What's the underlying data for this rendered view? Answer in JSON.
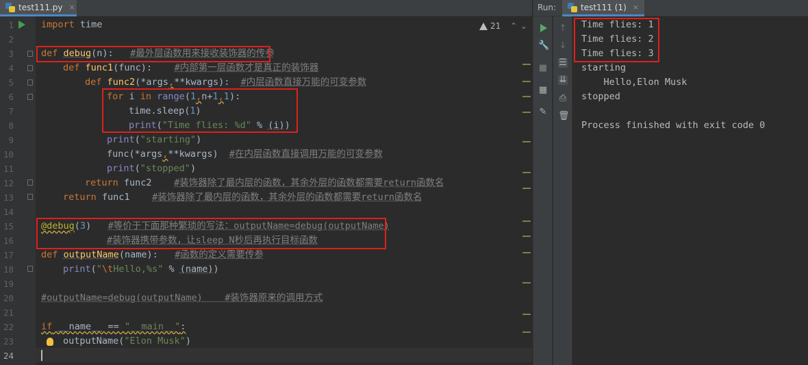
{
  "editor": {
    "tab_label": "test111.py",
    "tab_close": "×",
    "warnings_count": "21",
    "line_numbers": [
      "1",
      "2",
      "3",
      "4",
      "5",
      "6",
      "7",
      "8",
      "9",
      "10",
      "11",
      "12",
      "13",
      "14",
      "15",
      "16",
      "17",
      "18",
      "19",
      "20",
      "21",
      "22",
      "23",
      "24"
    ]
  },
  "code": {
    "l1_kw": "import",
    "l1_rest": " time",
    "l3_kw": "def",
    "l3_fn": "debug",
    "l3_rest": "(n):   ",
    "l3_cm": "#最外层函数用来接收装饰器的传参",
    "l4_kw": "def",
    "l4_fn": "func1",
    "l4_rest": "(func):    ",
    "l4_cm": "#内部第一层函数才是真正的装饰器",
    "l5_kw": "def",
    "l5_fn": "func2",
    "l5_a": "(*args",
    "l5_b": ",",
    "l5_c": "**kwargs):  ",
    "l5_cm": "#内层函数直接万能的可变参数",
    "l6_kw1": "for",
    "l6_a": " i ",
    "l6_kw2": "in",
    "l6_bi": " range",
    "l6_b": "(",
    "l6_n1": "1",
    "l6_c": ",",
    "l6_d": "n+",
    "l6_n2": "1",
    "l6_e": ",",
    "l6_n3": "1",
    "l6_f": "):",
    "l7_a": "time.sleep(",
    "l7_n": "1",
    "l7_b": ")",
    "l8_bi": "print",
    "l8_a": "(",
    "l8_str": "\"Time flies: %d\"",
    "l8_b": " % ",
    "l8_c": "(i)",
    "l8_d": ")",
    "l9_bi": "print",
    "l9_a": "(",
    "l9_str": "\"starting\"",
    "l9_b": ")",
    "l10_a": "func(*args",
    "l10_b": ",",
    "l10_c": "**kwargs)  ",
    "l10_cm": "#在内层函数直接调用万能的可变参数",
    "l11_bi": "print",
    "l11_a": "(",
    "l11_str": "\"stopped\"",
    "l11_b": ")",
    "l12_kw": "return",
    "l12_a": " func2    ",
    "l12_cm": "#装饰器除了最内层的函数，其余外层的函数都需要return函数名",
    "l13_kw": "return",
    "l13_a": " func1    ",
    "l13_cm": "#装饰器除了最内层的函数，其余外层的函数都需要return函数名",
    "l15_dec": "@debug",
    "l15_a": "(",
    "l15_n": "3",
    "l15_b": ")   ",
    "l15_cm": "#等价于下面那种繁琐的写法：outputName=debug(outputName)",
    "l16_cm": "#装饰器携带参数，让sleep N秒后再执行目标函数",
    "l17_kw": "def",
    "l17_fn": "outputName",
    "l17_a": "(name):   ",
    "l17_cm": "#函数的定义需要传参",
    "l18_bi": "print",
    "l18_a": "(",
    "l18_str1": "\"",
    "l18_esc": "\\t",
    "l18_str2": "Hello,%s\"",
    "l18_b": " % ",
    "l18_c": "(name)",
    "l18_d": ")",
    "l20_cm": "#outputName=debug(outputName)    #装饰器原来的调用方式",
    "l22_kw": "if",
    "l22_a": " __name__ == ",
    "l22_str": "\"__main__\"",
    "l22_b": ":",
    "l23_a": "outputName(",
    "l23_str": "\"Elon Musk\"",
    "l23_b": ")"
  },
  "run": {
    "label": "Run:",
    "tab_label": "test111 (1)",
    "tab_close": "×",
    "output": [
      "Time flies: 1",
      "Time flies: 2",
      "Time flies: 3",
      "starting",
      "    Hello,Elon Musk",
      "stopped",
      "",
      "Process finished with exit code 0"
    ]
  },
  "colors": {
    "highlight_box": "#e0201d",
    "keyword": "#cc7832",
    "function": "#ffc66d",
    "string": "#6a8759",
    "comment": "#808080",
    "number": "#6897bb",
    "decorator": "#bbb529"
  },
  "icons": [
    "python-file-icon",
    "run-gutter-icon",
    "warning-icon",
    "rerun-icon",
    "wrench-icon",
    "stop-icon",
    "layout-icon",
    "pin-icon",
    "up-arrow-icon",
    "down-arrow-icon",
    "soft-wrap-icon",
    "scroll-to-end-icon",
    "print-icon",
    "trash-icon",
    "lightbulb-icon"
  ]
}
